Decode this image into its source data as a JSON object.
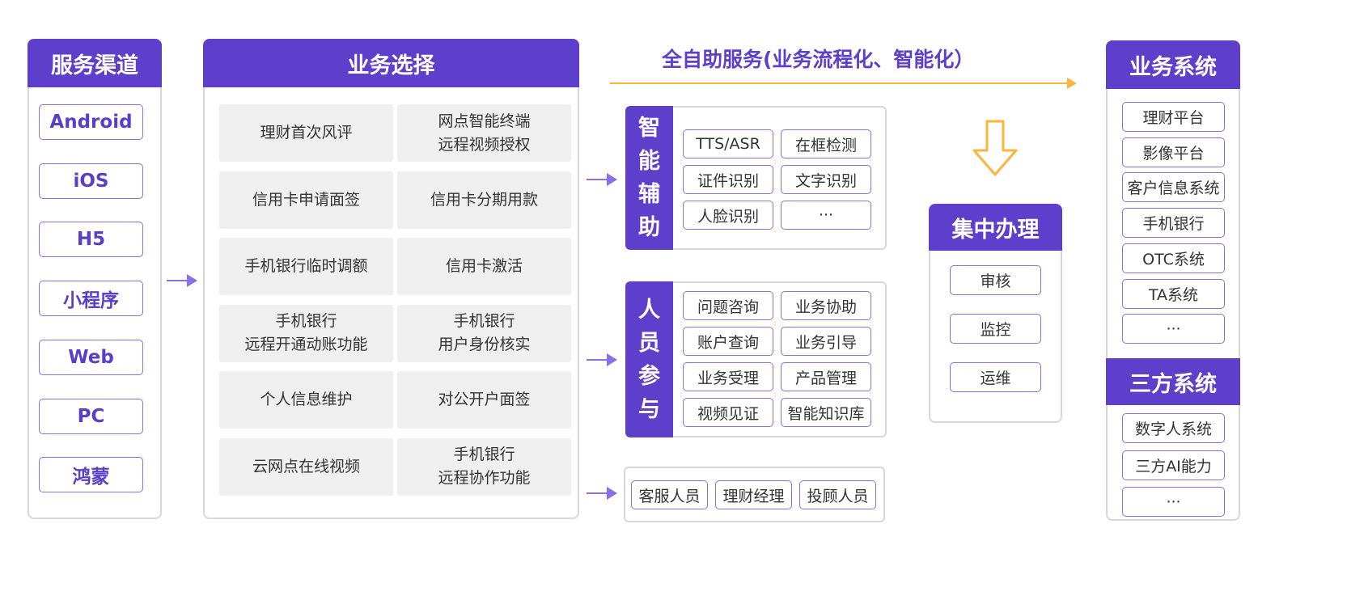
{
  "channels": {
    "title": "服务渠道",
    "items": [
      "Android",
      "iOS",
      "H5",
      "小程序",
      "Web",
      "PC",
      "鸿蒙"
    ]
  },
  "business": {
    "title": "业务选择",
    "tiles": [
      [
        "理财首次风评"
      ],
      [
        "网点智能终端",
        "远程视频授权"
      ],
      [
        "信用卡申请面签"
      ],
      [
        "信用卡分期用款"
      ],
      [
        "手机银行临时调额"
      ],
      [
        "信用卡激活"
      ],
      [
        "手机银行",
        "远程开通动账功能"
      ],
      [
        "手机银行",
        "用户身份核实"
      ],
      [
        "个人信息维护"
      ],
      [
        "对公开户面签"
      ],
      [
        "云网点在线视频"
      ],
      [
        "手机银行",
        "远程协作功能"
      ]
    ]
  },
  "self_service": {
    "title": "全自助服务(业务流程化、智能化）"
  },
  "smart_assist": {
    "label_chars": [
      "智",
      "能",
      "辅",
      "助"
    ],
    "items": [
      "TTS/ASR",
      "在框检测",
      "证件识别",
      "文字识别",
      "人脸识别",
      "···"
    ]
  },
  "human": {
    "label_chars": [
      "人",
      "员",
      "参",
      "与"
    ],
    "items": [
      "问题咨询",
      "业务协助",
      "账户查询",
      "业务引导",
      "业务受理",
      "产品管理",
      "视频见证",
      "智能知识库"
    ]
  },
  "staff": {
    "items": [
      "客服人员",
      "理财经理",
      "投顾人员"
    ]
  },
  "central": {
    "title": "集中办理",
    "items": [
      "审核",
      "监控",
      "运维"
    ]
  },
  "biz_systems": {
    "title": "业务系统",
    "items": [
      "理财平台",
      "影像平台",
      "客户信息系统",
      "手机银行",
      "OTC系统",
      "TA系统",
      "···"
    ]
  },
  "third_party": {
    "title": "三方系统",
    "items": [
      "数字人系统",
      "三方AI能力",
      "···"
    ]
  },
  "colors": {
    "primary": "#5e3fcb",
    "chip_border": "#8b6ee8",
    "orange": "#fbb43d",
    "tile_bg": "#efefef"
  }
}
